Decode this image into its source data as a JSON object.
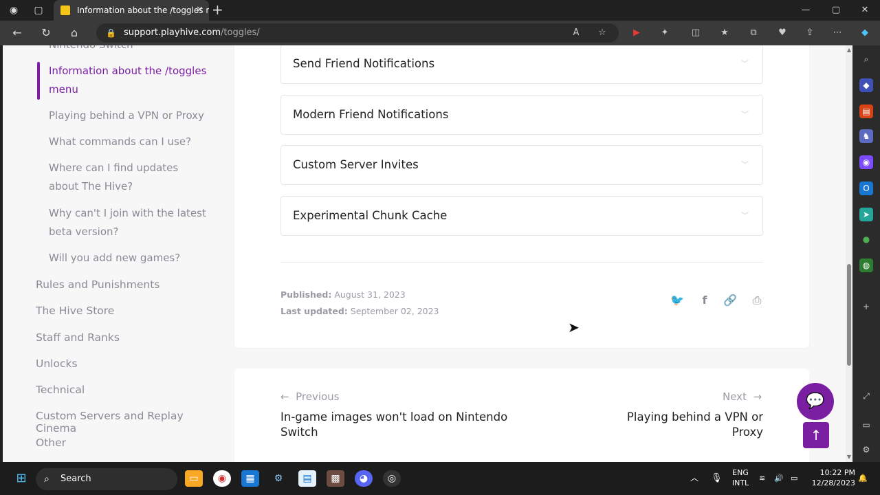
{
  "browser": {
    "tab_title": "Information about the /toggles m",
    "url_host": "support.playhive.com",
    "url_path": "/toggles/"
  },
  "sidebar": {
    "cut_item": "Nintendo Switch",
    "sub_items": [
      {
        "label": "Information about the /toggles menu",
        "active": true
      },
      {
        "label": "Playing behind a VPN or Proxy"
      },
      {
        "label": "What commands can I use?"
      },
      {
        "label": "Where can I find updates about The Hive?"
      },
      {
        "label": "Why can't I join with the latest beta version?"
      },
      {
        "label": "Will you add new games?"
      }
    ],
    "top_items": [
      "Rules and Punishments",
      "The Hive Store",
      "Staff and Ranks",
      "Unlocks",
      "Technical",
      "Custom Servers and Replay Cinema",
      "Other"
    ]
  },
  "accordions": [
    "Send Friend Notifications",
    "Modern Friend Notifications",
    "Custom Server Invites",
    "Experimental Chunk Cache"
  ],
  "meta": {
    "published_label": "Published:",
    "published_value": "August 31, 2023",
    "updated_label": "Last updated:",
    "updated_value": "September 02, 2023"
  },
  "pager": {
    "prev_label": "Previous",
    "prev_title": "In-game images won't load on Nintendo Switch",
    "next_label": "Next",
    "next_title": "Playing behind a VPN or Proxy"
  },
  "taskbar": {
    "search_placeholder": "Search",
    "lang_top": "ENG",
    "lang_bottom": "INTL",
    "time": "10:22 PM",
    "date": "12/28/2023"
  },
  "colors": {
    "accent": "#7b1fa2"
  }
}
